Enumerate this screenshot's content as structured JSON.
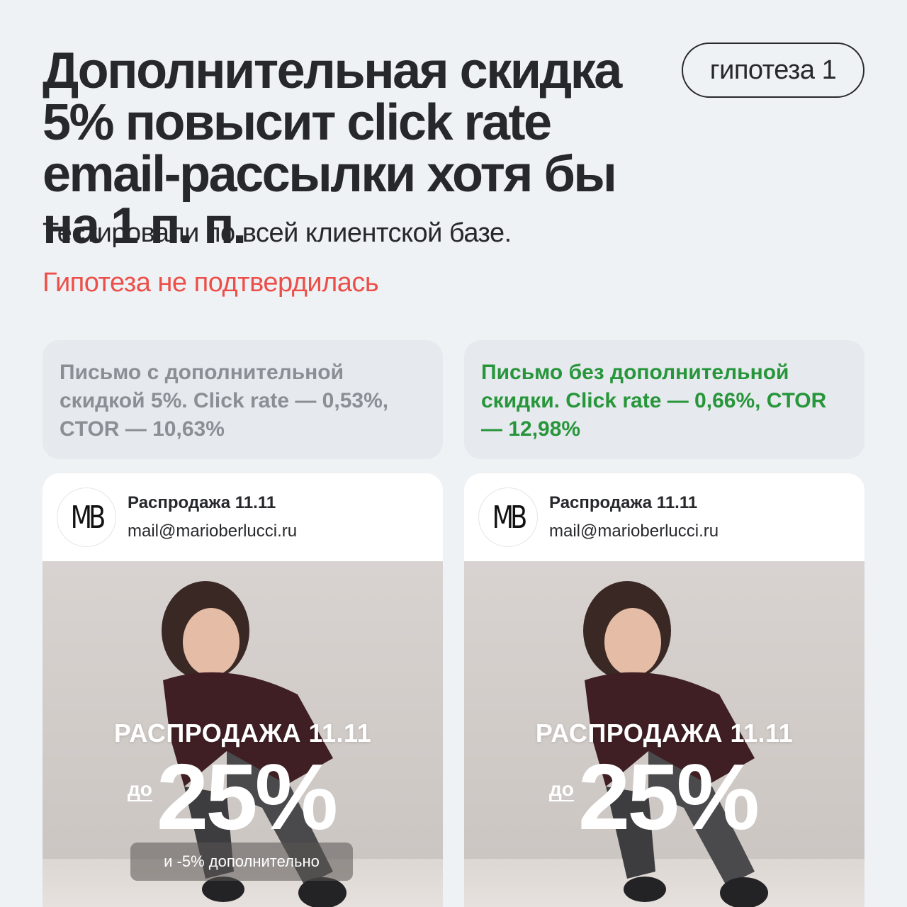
{
  "header": {
    "title": "Дополнительная скидка 5% повысит click rate email-рассылки хотя бы на 1 п. п.",
    "badge": "гипотеза 1",
    "subtitle": "Тестировали по всей клиентской базе.",
    "result": "Гипотеза не подтвердилась"
  },
  "colors": {
    "background": "#eff2f5",
    "result_red": "#ec4f4a",
    "winner_green": "#27963b",
    "muted_gray": "#8b8e95"
  },
  "variants": [
    {
      "note": "Письмо с дополнительной скидкой 5%. Click rate — 0,53%, CTOR — 10,63%",
      "email": {
        "logo": "MB",
        "subject": "Распродажа 11.11",
        "sender": "mail@marioberlucci.ru",
        "banner_title": "РАСПРОДАЖА 11.11",
        "banner_prefix": "до",
        "banner_discount": "25%",
        "banner_extra": "и -5% дополнительно"
      }
    },
    {
      "note": "Письмо без дополнительной скидки. Click rate — 0,66%, CTOR — 12,98%",
      "email": {
        "logo": "MB",
        "subject": "Распродажа 11.11",
        "sender": "mail@marioberlucci.ru",
        "banner_title": "РАСПРОДАЖА 11.11",
        "banner_prefix": "до",
        "banner_discount": "25%"
      }
    }
  ]
}
